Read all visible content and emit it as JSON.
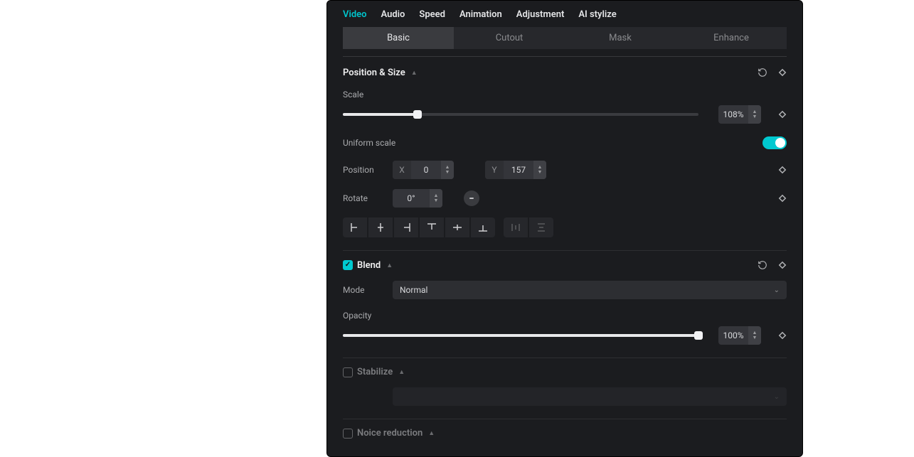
{
  "tabs": {
    "video": "Video",
    "audio": "Audio",
    "speed": "Speed",
    "animation": "Animation",
    "adjustment": "Adjustment",
    "ai_stylize": "AI stylize"
  },
  "subtabs": {
    "basic": "Basic",
    "cutout": "Cutout",
    "mask": "Mask",
    "enhance": "Enhance"
  },
  "position_size": {
    "title": "Position & Size",
    "scale_label": "Scale",
    "scale_value": "108%",
    "scale_percent": 21,
    "uniform_label": "Uniform scale",
    "uniform_on": true,
    "position_label": "Position",
    "x_label": "X",
    "x_value": "0",
    "y_label": "Y",
    "y_value": "157",
    "rotate_label": "Rotate",
    "rotate_value": "0°"
  },
  "blend": {
    "title": "Blend",
    "checked": true,
    "mode_label": "Mode",
    "mode_value": "Normal",
    "opacity_label": "Opacity",
    "opacity_value": "100%",
    "opacity_percent": 100
  },
  "stabilize": {
    "title": "Stabilize",
    "checked": false,
    "placeholder": ""
  },
  "noise": {
    "title": "Noice reduction",
    "checked": false
  }
}
